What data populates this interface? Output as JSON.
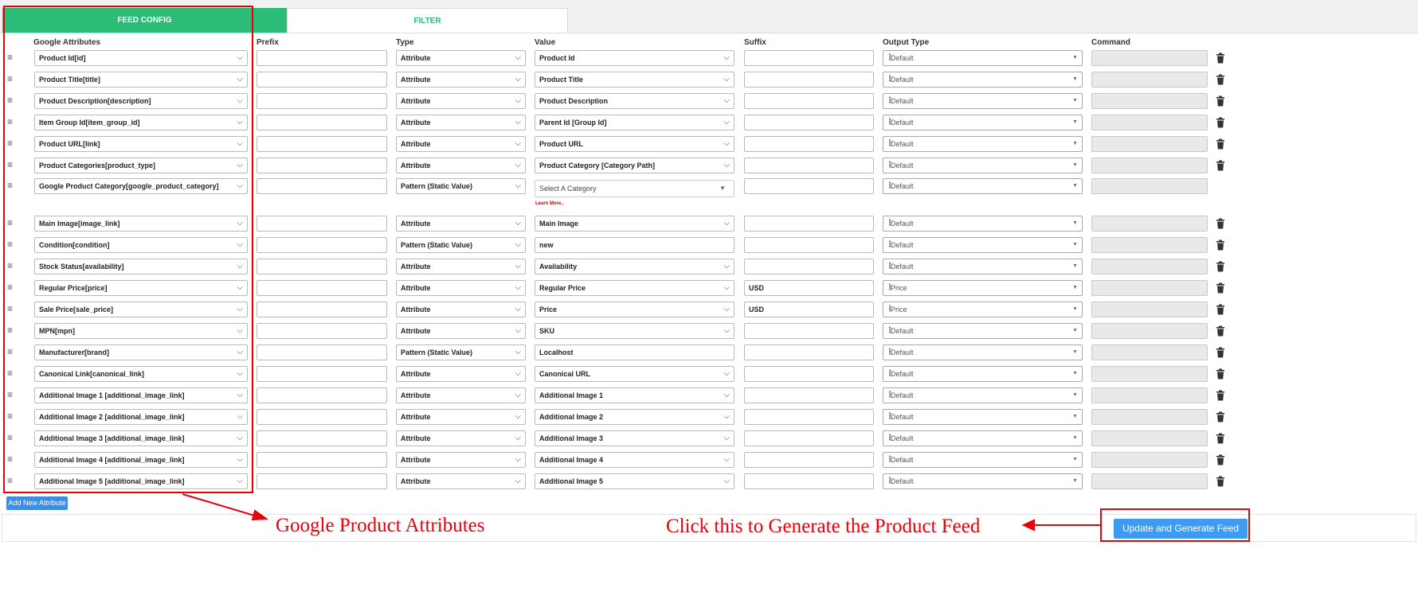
{
  "tabs": {
    "feed_config": "FEED CONFIG",
    "filter": "FILTER"
  },
  "columns": {
    "google_attributes": "Google Attributes",
    "prefix": "Prefix",
    "type": "Type",
    "value": "Value",
    "suffix": "Suffix",
    "output_type": "Output Type",
    "command": "Command"
  },
  "rows": [
    {
      "attribute": "Product Id[id]",
      "prefix": "",
      "type": "Attribute",
      "value": "Product Id",
      "value_kind": "select",
      "suffix": "",
      "output": "Default",
      "command": ""
    },
    {
      "attribute": "Product Title[title]",
      "prefix": "",
      "type": "Attribute",
      "value": "Product Title",
      "value_kind": "select",
      "suffix": "",
      "output": "Default",
      "command": ""
    },
    {
      "attribute": "Product Description[description]",
      "prefix": "",
      "type": "Attribute",
      "value": "Product Description",
      "value_kind": "select",
      "suffix": "",
      "output": "Default",
      "command": ""
    },
    {
      "attribute": "Item Group Id[item_group_id]",
      "prefix": "",
      "type": "Attribute",
      "value": "Parent Id [Group Id]",
      "value_kind": "select",
      "suffix": "",
      "output": "Default",
      "command": ""
    },
    {
      "attribute": "Product URL[link]",
      "prefix": "",
      "type": "Attribute",
      "value": "Product URL",
      "value_kind": "select",
      "suffix": "",
      "output": "Default",
      "command": ""
    },
    {
      "attribute": "Product Categories[product_type]",
      "prefix": "",
      "type": "Attribute",
      "value": "Product Category [Category Path]",
      "value_kind": "select",
      "suffix": "",
      "output": "Default",
      "command": ""
    },
    {
      "attribute": "Google Product Category[google_product_category]",
      "prefix": "",
      "type": "Pattern (Static Value)",
      "value": "Select A Category",
      "value_kind": "category",
      "suffix": "",
      "output": "Default",
      "command": "",
      "learn_more": "Learn More..",
      "no_trash": true
    },
    {
      "attribute": "Main Image[image_link]",
      "prefix": "",
      "type": "Attribute",
      "value": "Main Image",
      "value_kind": "select",
      "suffix": "",
      "output": "Default",
      "command": ""
    },
    {
      "attribute": "Condition[condition]",
      "prefix": "",
      "type": "Pattern (Static Value)",
      "value": "new",
      "value_kind": "text",
      "suffix": "",
      "output": "Default",
      "command": ""
    },
    {
      "attribute": "Stock Status[availability]",
      "prefix": "",
      "type": "Attribute",
      "value": "Availability",
      "value_kind": "select",
      "suffix": "",
      "output": "Default",
      "command": ""
    },
    {
      "attribute": "Regular Price[price]",
      "prefix": "",
      "type": "Attribute",
      "value": "Regular Price",
      "value_kind": "select",
      "suffix": "USD",
      "output": "Price",
      "command": ""
    },
    {
      "attribute": "Sale Price[sale_price]",
      "prefix": "",
      "type": "Attribute",
      "value": "Price",
      "value_kind": "select",
      "suffix": "USD",
      "output": "Price",
      "command": ""
    },
    {
      "attribute": "MPN[mpn]",
      "prefix": "",
      "type": "Attribute",
      "value": "SKU",
      "value_kind": "select",
      "suffix": "",
      "output": "Default",
      "command": ""
    },
    {
      "attribute": "Manufacturer[brand]",
      "prefix": "",
      "type": "Pattern (Static Value)",
      "value": "Localhost",
      "value_kind": "text",
      "suffix": "",
      "output": "Default",
      "command": ""
    },
    {
      "attribute": "Canonical Link[canonical_link]",
      "prefix": "",
      "type": "Attribute",
      "value": "Canonical URL",
      "value_kind": "select",
      "suffix": "",
      "output": "Default",
      "command": ""
    },
    {
      "attribute": "Additional Image 1 [additional_image_link]",
      "prefix": "",
      "type": "Attribute",
      "value": "Additional Image 1",
      "value_kind": "select",
      "suffix": "",
      "output": "Default",
      "command": ""
    },
    {
      "attribute": "Additional Image 2 [additional_image_link]",
      "prefix": "",
      "type": "Attribute",
      "value": "Additional Image 2",
      "value_kind": "select",
      "suffix": "",
      "output": "Default",
      "command": ""
    },
    {
      "attribute": "Additional Image 3 [additional_image_link]",
      "prefix": "",
      "type": "Attribute",
      "value": "Additional Image 3",
      "value_kind": "select",
      "suffix": "",
      "output": "Default",
      "command": ""
    },
    {
      "attribute": "Additional Image 4 [additional_image_link]",
      "prefix": "",
      "type": "Attribute",
      "value": "Additional Image 4",
      "value_kind": "select",
      "suffix": "",
      "output": "Default",
      "command": ""
    },
    {
      "attribute": "Additional Image 5 [additional_image_link]",
      "prefix": "",
      "type": "Attribute",
      "value": "Additional Image 5",
      "value_kind": "select",
      "suffix": "",
      "output": "Default",
      "command": ""
    }
  ],
  "buttons": {
    "add_new_attribute": "Add New Attribute",
    "update_generate": "Update and Generate Feed"
  },
  "annotations": {
    "attributes_label": "Google Product Attributes",
    "generate_label": "Click this to Generate the Product Feed",
    "color": "#e8000b"
  },
  "colors": {
    "accent_green": "#2bbc77",
    "button_blue": "#3d9cf1",
    "delete_icon": "#333333"
  },
  "icons": {
    "row_handle": "drag-handle-icon",
    "row_delete": "trash-icon",
    "select_caret": "chevron-down-icon",
    "output_dots": "vertical-dots-icon"
  }
}
